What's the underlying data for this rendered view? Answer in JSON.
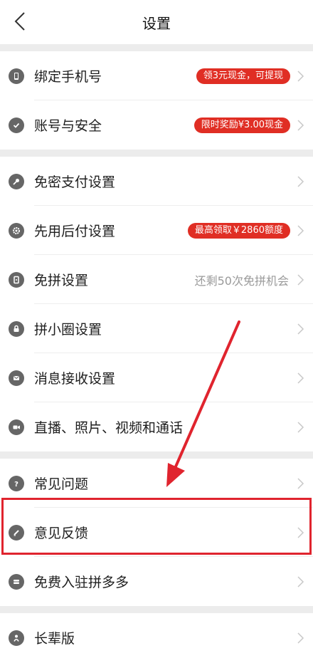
{
  "header": {
    "title": "设置"
  },
  "groups": [
    {
      "items": [
        {
          "label": "绑定手机号",
          "icon": "phone-icon",
          "badge": "领3元现金，可提现"
        },
        {
          "label": "账号与安全",
          "icon": "shield-check-icon",
          "badge": "限时奖励¥3.00现金"
        }
      ]
    },
    {
      "items": [
        {
          "label": "免密支付设置",
          "icon": "key-icon"
        },
        {
          "label": "先用后付设置",
          "icon": "gear-icon",
          "badge": "最高领取￥2860额度"
        },
        {
          "label": "免拼设置",
          "icon": "mobile-icon",
          "hint": "还剩50次免拼机会"
        },
        {
          "label": "拼小圈设置",
          "icon": "lock-icon"
        },
        {
          "label": "消息接收设置",
          "icon": "message-icon"
        },
        {
          "label": "直播、照片、视频和通话",
          "icon": "video-camera-icon"
        }
      ]
    },
    {
      "items": [
        {
          "label": "常见问题",
          "icon": "question-icon"
        },
        {
          "label": "意见反馈",
          "icon": "pencil-icon"
        },
        {
          "label": "免费入驻拼多多",
          "icon": "store-icon"
        }
      ]
    },
    {
      "items": [
        {
          "label": "长辈版",
          "icon": "elder-icon"
        }
      ]
    }
  ],
  "colors": {
    "badge": "#e02e24",
    "icon": "#666666",
    "annotation": "#e0242e",
    "hint": "#9a9a9a"
  }
}
